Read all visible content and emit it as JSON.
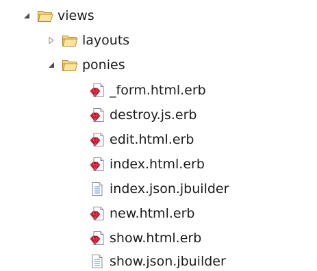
{
  "tree": {
    "root": {
      "label": "views",
      "state": "expanded",
      "icon": "folder-open-icon",
      "children": [
        {
          "label": "layouts",
          "state": "collapsed",
          "icon": "folder-open-icon"
        },
        {
          "label": "ponies",
          "state": "expanded",
          "icon": "folder-open-icon",
          "files": [
            {
              "label": "_form.html.erb",
              "icon": "ruby-file-icon"
            },
            {
              "label": "destroy.js.erb",
              "icon": "ruby-file-icon"
            },
            {
              "label": "edit.html.erb",
              "icon": "ruby-file-icon"
            },
            {
              "label": "index.html.erb",
              "icon": "ruby-file-icon"
            },
            {
              "label": "index.json.jbuilder",
              "icon": "text-file-icon"
            },
            {
              "label": "new.html.erb",
              "icon": "ruby-file-icon"
            },
            {
              "label": "show.html.erb",
              "icon": "ruby-file-icon"
            },
            {
              "label": "show.json.jbuilder",
              "icon": "text-file-icon"
            }
          ]
        }
      ]
    }
  },
  "colors": {
    "folder": "#e8c25a",
    "folder_outline": "#b8891f",
    "ruby": "#c8102e",
    "text_file_line": "#5a8ad8"
  }
}
